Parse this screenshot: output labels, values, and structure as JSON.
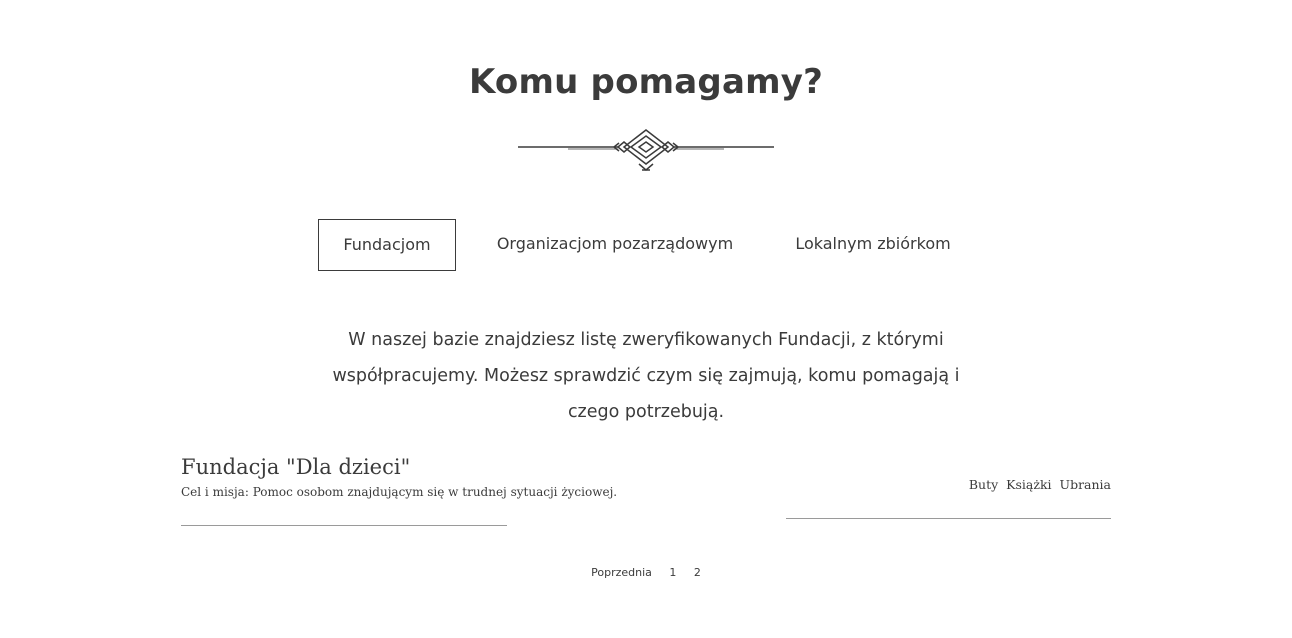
{
  "heading": "Komu pomagamy?",
  "decoration_icon": "ornament-divider-icon",
  "tabs": [
    {
      "label": "Fundacjom",
      "active": true
    },
    {
      "label": "Organizacjom pozarządowym",
      "active": false
    },
    {
      "label": "Lokalnym zbiórkom",
      "active": false
    }
  ],
  "description": "W naszej bazie znajdziesz listę zweryfikowanych Fundacji, z którymi współpracujemy. Możesz sprawdzić czym się zajmują, komu pomagają i czego potrzebują.",
  "items": [
    {
      "title": "Fundacja \"Dla dzieci\"",
      "mission": "Cel i misja: Pomoc osobom znajdującym się w trudnej sytuacji życiowej.",
      "needs": [
        "Buty",
        "Książki",
        "Ubrania"
      ]
    }
  ],
  "pagination": {
    "prev_label": "Poprzednia",
    "pages": [
      "1",
      "2"
    ]
  },
  "colors": {
    "text": "#3b3b3b",
    "divider": "#9a9a9a",
    "background": "#ffffff"
  }
}
